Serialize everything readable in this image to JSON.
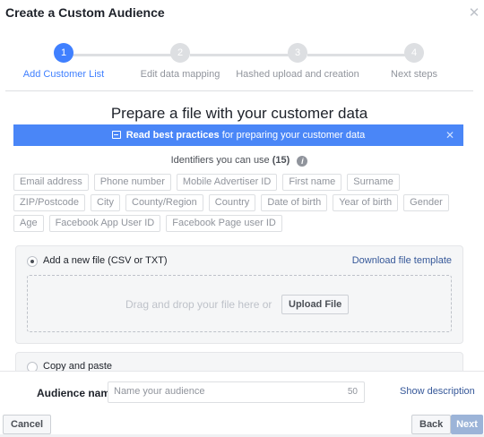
{
  "header": {
    "title": "Create a Custom Audience",
    "close_glyph": "✕"
  },
  "stepper": {
    "steps": [
      {
        "number": "1",
        "label": "Add Customer List",
        "active": true
      },
      {
        "number": "2",
        "label": "Edit data mapping",
        "active": false
      },
      {
        "number": "3",
        "label": "Hashed upload and creation",
        "active": false
      },
      {
        "number": "4",
        "label": "Next steps",
        "active": false
      }
    ]
  },
  "main": {
    "section_title": "Prepare a file with your customer data",
    "banner": {
      "bold_text": "Read best practices",
      "rest_text": " for preparing your customer data",
      "close_glyph": "✕"
    },
    "identifiers": {
      "heading": "Identifiers you can use",
      "count": "(15)",
      "chips": [
        "Email address",
        "Phone number",
        "Mobile Advertiser ID",
        "First name",
        "Surname",
        "ZIP/Postcode",
        "City",
        "County/Region",
        "Country",
        "Date of birth",
        "Year of birth",
        "Gender",
        "Age",
        "Facebook App User ID",
        "Facebook Page user ID"
      ]
    },
    "upload": {
      "option_label": "Add a new file (CSV or TXT)",
      "download_link": "Download file template",
      "drop_text": "Drag and drop your file here or",
      "upload_button": "Upload File"
    },
    "copy_paste": {
      "option_label": "Copy and paste"
    }
  },
  "footer": {
    "audience_label": "Audience name",
    "audience_placeholder": "Name your audience",
    "char_count": "50",
    "show_description": "Show description",
    "cancel_label": "Cancel",
    "back_label": "Back",
    "next_label": "Next"
  },
  "colors": {
    "accent": "#4080ff",
    "banner": "#4a86f7",
    "link": "#365899",
    "next_disabled": "#9cb4d8"
  }
}
